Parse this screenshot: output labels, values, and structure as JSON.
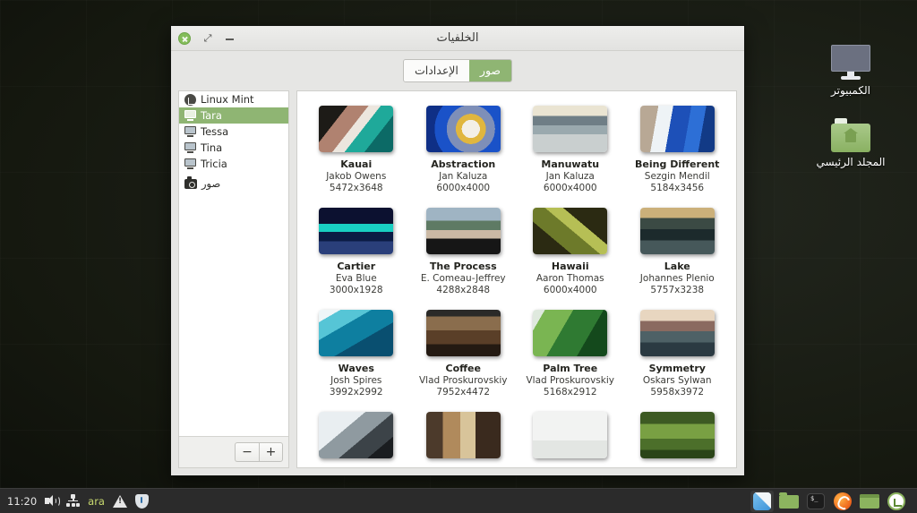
{
  "desktop": {
    "icons": [
      {
        "name": "الكمبيوتر",
        "icon": "computer-monitor-icon"
      },
      {
        "name": "المجلد الرئيسي",
        "icon": "home-folder-icon"
      }
    ]
  },
  "window": {
    "title": "الخلفيات",
    "controls": {
      "close": "close-icon",
      "maximize": "maximize-icon",
      "minimize": "minimize-icon"
    },
    "tabs": [
      {
        "label": "الإعدادات",
        "active": false
      },
      {
        "label": "صور",
        "active": true
      }
    ],
    "accent_color": "#8fb573"
  },
  "wallpapers": [
    {
      "name": "Kauai",
      "author": "Jakob Owens",
      "size": "5472x3648",
      "thumb": "th-kauai"
    },
    {
      "name": "Abstraction",
      "author": "Jan Kaluza",
      "size": "6000x4000",
      "thumb": "th-abstraction"
    },
    {
      "name": "Manuwatu",
      "author": "Jan Kaluza",
      "size": "6000x4000",
      "thumb": "th-manuwatu"
    },
    {
      "name": "Being Different",
      "author": "Sezgin Mendil",
      "size": "5184x3456",
      "thumb": "th-being"
    },
    {
      "name": "Cartier",
      "author": "Eva Blue",
      "size": "3000x1928",
      "thumb": "th-cartier"
    },
    {
      "name": "The Process",
      "author": "E. Comeau-Jeffrey",
      "size": "4288x2848",
      "thumb": "th-process"
    },
    {
      "name": "Hawaii",
      "author": "Aaron Thomas",
      "size": "6000x4000",
      "thumb": "th-hawaii"
    },
    {
      "name": "Lake",
      "author": "Johannes Plenio",
      "size": "5757x3238",
      "thumb": "th-lake"
    },
    {
      "name": "Waves",
      "author": "Josh Spires",
      "size": "3992x2992",
      "thumb": "th-waves"
    },
    {
      "name": "Coffee",
      "author": "Vlad Proskurovskiy",
      "size": "7952x4472",
      "thumb": "th-coffee"
    },
    {
      "name": "Palm Tree",
      "author": "Vlad Proskurovskiy",
      "size": "5168x2912",
      "thumb": "th-palm"
    },
    {
      "name": "Symmetry",
      "author": "Oskars Sylwan",
      "size": "5958x3972",
      "thumb": "th-symmetry"
    },
    {
      "name": "",
      "author": "",
      "size": "",
      "thumb": "th-clouds",
      "cut": true
    },
    {
      "name": "",
      "author": "",
      "size": "",
      "thumb": "th-arch",
      "cut": true
    },
    {
      "name": "",
      "author": "",
      "size": "",
      "thumb": "th-statue",
      "cut": true
    },
    {
      "name": "",
      "author": "",
      "size": "",
      "thumb": "th-hills",
      "cut": true
    }
  ],
  "sidebar": {
    "items": [
      {
        "label": "Linux Mint",
        "icon": "mint-logo-icon",
        "selected": false
      },
      {
        "label": "Tara",
        "icon": "monitor-icon",
        "selected": true
      },
      {
        "label": "Tessa",
        "icon": "monitor-icon",
        "selected": false
      },
      {
        "label": "Tina",
        "icon": "monitor-icon",
        "selected": false
      },
      {
        "label": "Tricia",
        "icon": "monitor-icon",
        "selected": false
      },
      {
        "label": "صور",
        "icon": "camera-icon",
        "selected": false
      }
    ],
    "remove_label": "−",
    "add_label": "+"
  },
  "taskbar": {
    "clock": "11:20",
    "keyboard_layout": "ara",
    "tray_icons": [
      "speaker-icon",
      "network-icon",
      "warning-icon",
      "shield-icon"
    ],
    "launchers": [
      {
        "icon": "files-app-icon",
        "active": true
      },
      {
        "icon": "folder-icon",
        "active": false
      },
      {
        "icon": "terminal-icon",
        "active": false
      },
      {
        "icon": "firefox-icon",
        "active": false
      },
      {
        "icon": "green-terminal-icon",
        "active": false
      },
      {
        "icon": "mint-menu-icon",
        "active": false
      }
    ]
  }
}
